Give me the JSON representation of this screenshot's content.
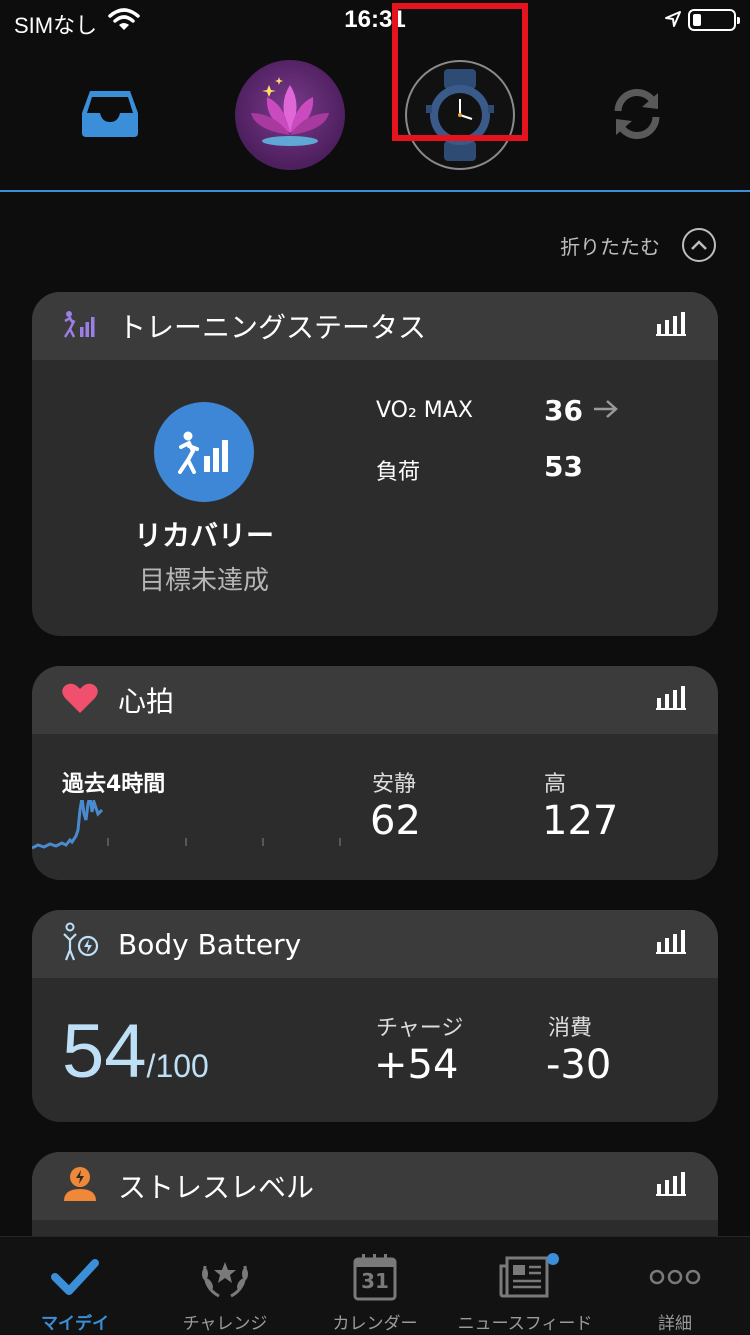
{
  "status_bar": {
    "carrier": "SIMなし",
    "time": "16:31"
  },
  "top_nav": {
    "collapse_label": "折りたたむ"
  },
  "training_status": {
    "title": "トレーニングステータス",
    "status": "リカバリー",
    "goal": "目標未達成",
    "vo2_label": "VO₂ MAX",
    "vo2_value": "36",
    "load_label": "負荷",
    "load_value": "53"
  },
  "heart_rate": {
    "title": "心拍",
    "period": "過去4時間",
    "resting_label": "安静",
    "resting_value": "62",
    "high_label": "高",
    "high_value": "127"
  },
  "body_battery": {
    "title": "Body Battery",
    "value": "54",
    "out_of": "/100",
    "charge_label": "チャージ",
    "charge_value": "+54",
    "drain_label": "消費",
    "drain_value": "-30"
  },
  "stress": {
    "title": "ストレスレベル"
  },
  "tab_bar": {
    "tabs": [
      {
        "label": "マイデイ",
        "icon": "checkmark-icon"
      },
      {
        "label": "チャレンジ",
        "icon": "laurel-icon"
      },
      {
        "label": "カレンダー",
        "icon": "calendar-icon"
      },
      {
        "label": "ニュースフィード",
        "icon": "newspaper-icon"
      },
      {
        "label": "詳細",
        "icon": "more-icon"
      }
    ],
    "calendar_day": "31"
  },
  "colors": {
    "accent": "#3a8fd8",
    "highlight": "#e4131d",
    "heart": "#f0506e",
    "battery": "#bde0f6"
  }
}
